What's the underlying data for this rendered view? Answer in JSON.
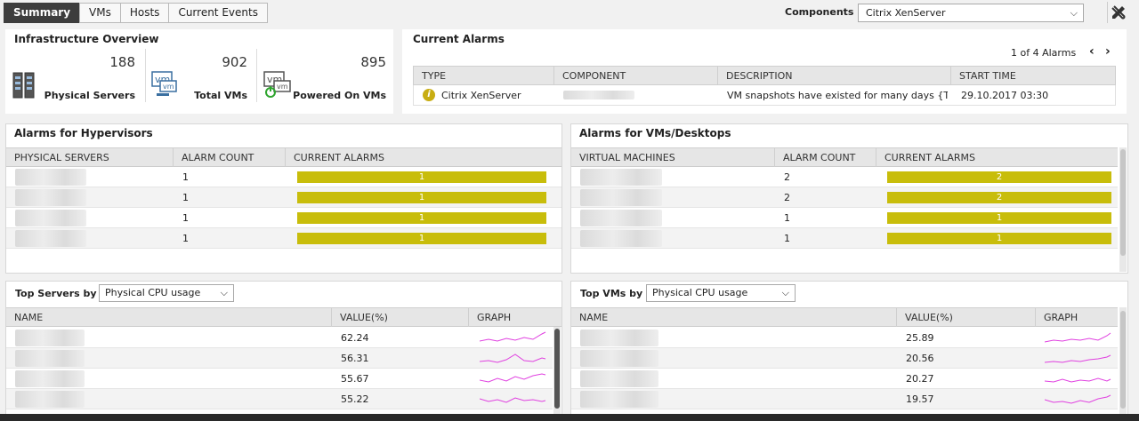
{
  "tabs": [
    {
      "label": "Summary",
      "active": true
    },
    {
      "label": "VMs",
      "active": false
    },
    {
      "label": "Hosts",
      "active": false
    },
    {
      "label": "Current Events",
      "active": false
    }
  ],
  "components": {
    "label": "Components :",
    "value": "Citrix XenServer"
  },
  "overview": {
    "title": "Infrastructure Overview",
    "stats": [
      {
        "value": "188",
        "label": "Physical Servers",
        "icon": "server-icon"
      },
      {
        "value": "902",
        "label": "Total VMs",
        "icon": "vm-icon"
      },
      {
        "value": "895",
        "label": "Powered On VMs",
        "icon": "vm-power-icon"
      }
    ]
  },
  "current_alarms": {
    "title": "Current Alarms",
    "pagination": "1 of 4 Alarms",
    "columns": [
      "TYPE",
      "COMPONENT",
      "DESCRIPTION",
      "START TIME"
    ],
    "rows": [
      {
        "type": "Citrix XenServer",
        "component": "",
        "description": "VM snapshots have existed for many days {T...",
        "start_time": "29.10.2017 03:30"
      }
    ]
  },
  "hyp_alarms": {
    "title": "Alarms for Hypervisors",
    "columns": [
      "PHYSICAL SERVERS",
      "ALARM COUNT",
      "CURRENT ALARMS"
    ],
    "rows": [
      {
        "count": "1",
        "bar": "1"
      },
      {
        "count": "1",
        "bar": "1"
      },
      {
        "count": "1",
        "bar": "1"
      },
      {
        "count": "1",
        "bar": "1"
      }
    ]
  },
  "vm_alarms": {
    "title": "Alarms for VMs/Desktops",
    "columns": [
      "VIRTUAL MACHINES",
      "ALARM COUNT",
      "CURRENT ALARMS"
    ],
    "rows": [
      {
        "count": "2",
        "bar": "2"
      },
      {
        "count": "2",
        "bar": "2"
      },
      {
        "count": "1",
        "bar": "1"
      },
      {
        "count": "1",
        "bar": "1"
      }
    ]
  },
  "top_servers": {
    "label": "Top Servers by",
    "metric": "Physical CPU usage",
    "columns": [
      "NAME",
      "VALUE(%)",
      "GRAPH"
    ],
    "rows": [
      {
        "value": "62.24"
      },
      {
        "value": "56.31"
      },
      {
        "value": "55.67"
      },
      {
        "value": "55.22"
      }
    ]
  },
  "top_vms": {
    "label": "Top VMs by",
    "metric": "Physical CPU usage",
    "columns": [
      "NAME",
      "VALUE(%)",
      "GRAPH"
    ],
    "rows": [
      {
        "value": "25.89"
      },
      {
        "value": "20.56"
      },
      {
        "value": "20.27"
      },
      {
        "value": "19.57"
      }
    ]
  },
  "colors": {
    "alarm_bar": "#c8bd0b",
    "sparkline": "#e040e0",
    "active_tab": "#3d3d3d"
  }
}
